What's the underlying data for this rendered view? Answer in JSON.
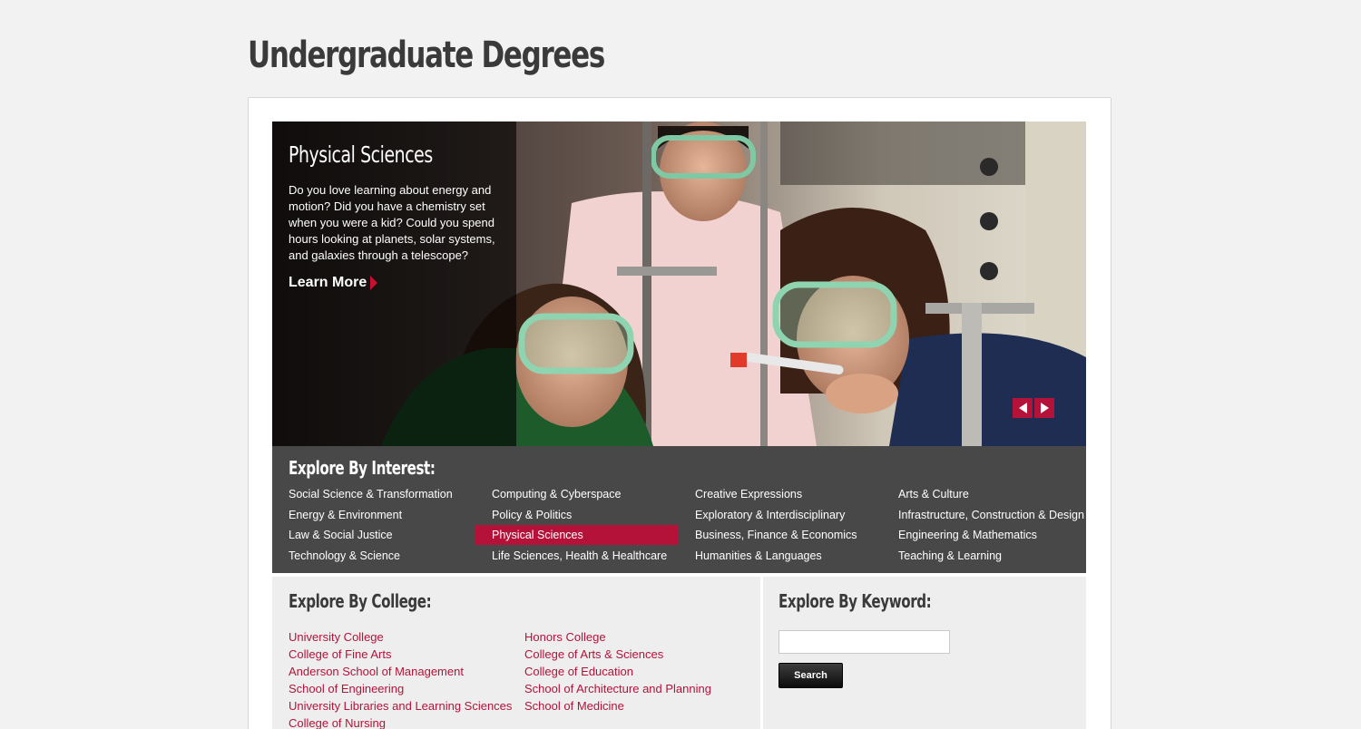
{
  "page": {
    "title": "Undergraduate Degrees"
  },
  "hero": {
    "title": "Physical Sciences",
    "description": "Do you love learning about energy and motion? Did you have a chemistry set when you were a kid? Could you spend hours looking at planets, solar systems, and galaxies through a telescope?",
    "learn_more": "Learn More",
    "prev_icon": "arrow-left-icon",
    "next_icon": "arrow-right-icon"
  },
  "interest": {
    "heading": "Explore By Interest:",
    "selected": "Physical Sciences",
    "columns": [
      [
        "Social Science & Transformation",
        "Energy & Environment",
        "Law & Social Justice",
        "Technology & Science"
      ],
      [
        "Computing & Cyberspace",
        "Policy & Politics",
        "Physical Sciences",
        "Life Sciences, Health & Healthcare"
      ],
      [
        "Creative Expressions",
        "Exploratory & Interdisciplinary",
        "Business, Finance & Economics",
        "Humanities & Languages"
      ],
      [
        "Arts & Culture",
        "Infrastructure, Construction & Design",
        "Engineering & Mathematics",
        "Teaching & Learning"
      ]
    ]
  },
  "college": {
    "heading": "Explore By College:",
    "left": [
      "University College",
      "College of Fine Arts",
      "Anderson School of Management",
      "School of Engineering",
      "University Libraries and Learning Sciences",
      "College of Nursing"
    ],
    "right": [
      "Honors College",
      "College of Arts & Sciences",
      "College of Education",
      "School of Architecture and Planning",
      "School of Medicine"
    ]
  },
  "keyword": {
    "heading": "Explore By Keyword:",
    "input_value": "",
    "button_label": "Search"
  },
  "colors": {
    "accent": "#b5123a",
    "dark_band": "#484848",
    "background": "#f2f2f2"
  }
}
